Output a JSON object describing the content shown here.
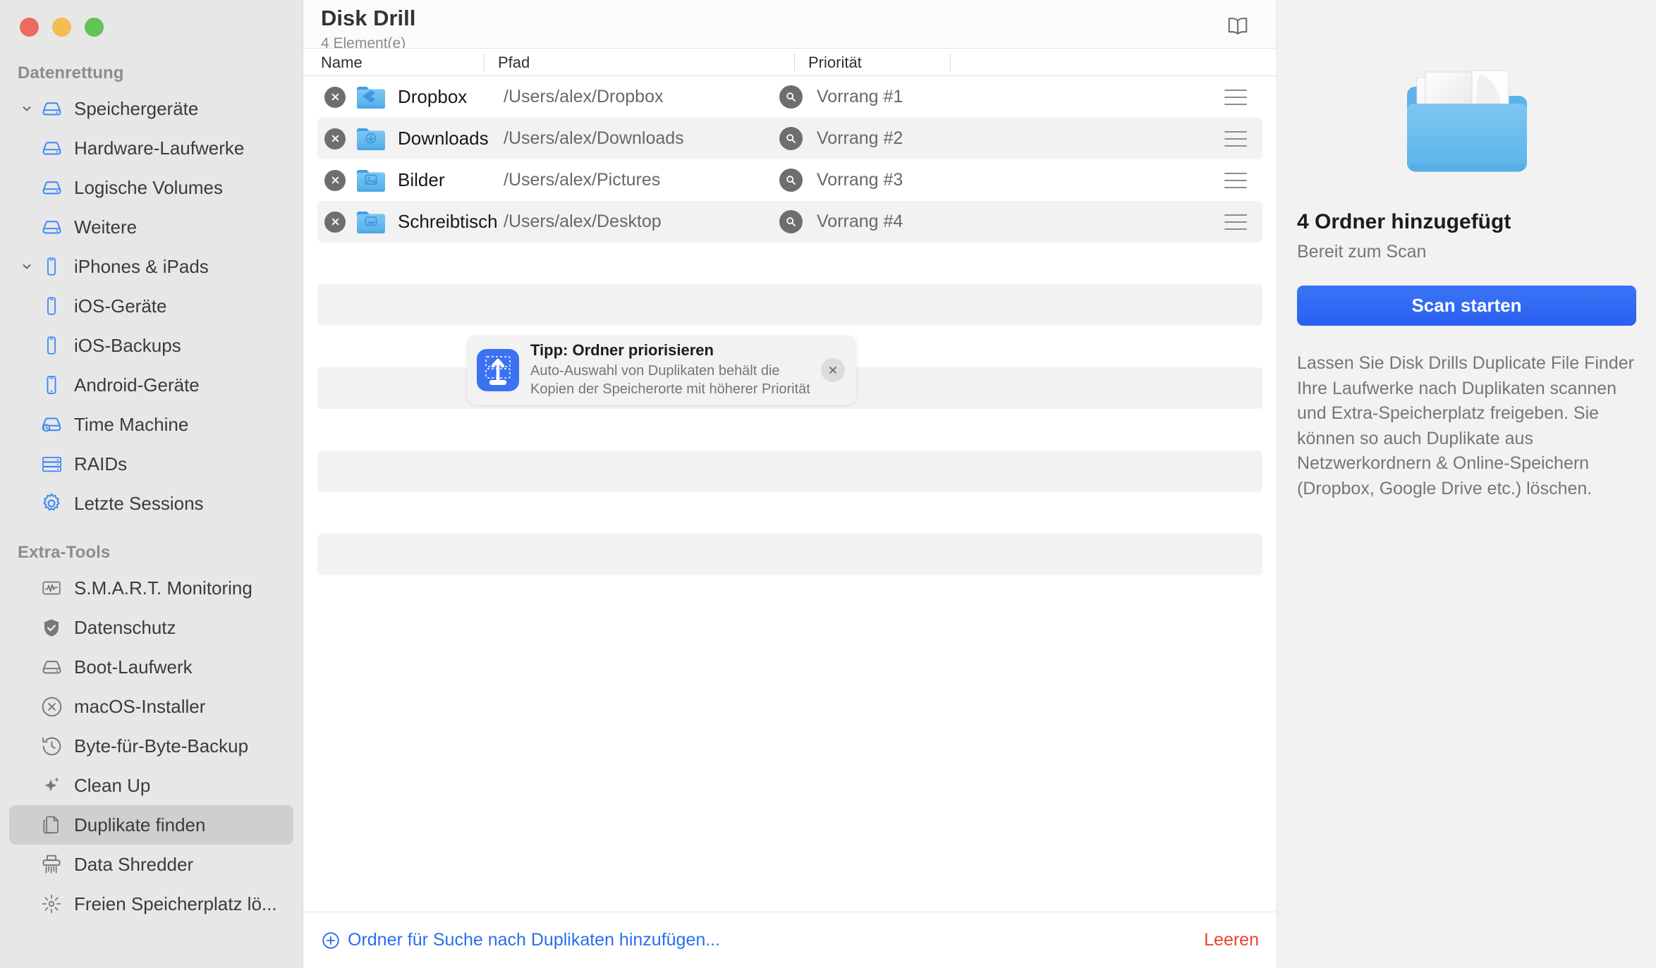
{
  "window": {
    "traffic_lights": [
      "close",
      "minimize",
      "zoom"
    ],
    "colors": {
      "close": "#ec6a5e",
      "minimize": "#f4bd4f",
      "zoom": "#61c454",
      "accent_blue": "#2a6ef0",
      "danger_red": "#e8452c"
    }
  },
  "sidebar": {
    "sections": [
      {
        "title": "Datenrettung",
        "items": [
          {
            "label": "Speichergeräte",
            "icon": "drive-icon",
            "indent": 0,
            "expandable": true,
            "expanded": true,
            "selected": false
          },
          {
            "label": "Hardware-Laufwerke",
            "icon": "drive-icon",
            "indent": 1,
            "expandable": false,
            "selected": false
          },
          {
            "label": "Logische Volumes",
            "icon": "drive-icon",
            "indent": 1,
            "expandable": false,
            "selected": false
          },
          {
            "label": "Weitere",
            "icon": "drive-icon",
            "indent": 1,
            "expandable": false,
            "selected": false
          },
          {
            "label": "iPhones & iPads",
            "icon": "phone-icon",
            "indent": 0,
            "expandable": true,
            "expanded": true,
            "selected": false
          },
          {
            "label": "iOS-Geräte",
            "icon": "phone-icon",
            "indent": 1,
            "expandable": false,
            "selected": false
          },
          {
            "label": "iOS-Backups",
            "icon": "phone-icon",
            "indent": 1,
            "expandable": false,
            "selected": false
          },
          {
            "label": "Android-Geräte",
            "icon": "android-phone-icon",
            "indent": 0,
            "expandable": false,
            "selected": false
          },
          {
            "label": "Time Machine",
            "icon": "time-machine-icon",
            "indent": 0,
            "expandable": false,
            "selected": false
          },
          {
            "label": "RAIDs",
            "icon": "raid-icon",
            "indent": 0,
            "expandable": false,
            "selected": false
          },
          {
            "label": "Letzte Sessions",
            "icon": "gear-icon",
            "indent": 0,
            "expandable": false,
            "selected": false
          }
        ]
      },
      {
        "title": "Extra-Tools",
        "items": [
          {
            "label": "S.M.A.R.T. Monitoring",
            "icon": "pulse-monitor-icon",
            "indent": 0,
            "expandable": false,
            "selected": false
          },
          {
            "label": "Datenschutz",
            "icon": "shield-check-icon",
            "indent": 0,
            "expandable": false,
            "selected": false
          },
          {
            "label": "Boot-Laufwerk",
            "icon": "drive-icon",
            "indent": 0,
            "expandable": false,
            "selected": false
          },
          {
            "label": "macOS-Installer",
            "icon": "x-circle-icon",
            "indent": 0,
            "expandable": false,
            "selected": false
          },
          {
            "label": "Byte-für-Byte-Backup",
            "icon": "clock-rewind-icon",
            "indent": 0,
            "expandable": false,
            "selected": false
          },
          {
            "label": "Clean Up",
            "icon": "sparkle-icon",
            "indent": 0,
            "expandable": false,
            "selected": false
          },
          {
            "label": "Duplikate finden",
            "icon": "copy-documents-icon",
            "indent": 0,
            "expandable": false,
            "selected": true
          },
          {
            "label": "Data Shredder",
            "icon": "shredder-icon",
            "indent": 0,
            "expandable": false,
            "selected": false
          },
          {
            "label": "Freien Speicherplatz lö...",
            "icon": "erase-sparkle-icon",
            "indent": 0,
            "expandable": false,
            "selected": false
          }
        ]
      }
    ]
  },
  "header": {
    "title": "Disk Drill",
    "subtitle": "4 Element(e)",
    "book_icon": "open-book-icon"
  },
  "table": {
    "columns": [
      {
        "key": "name",
        "label": "Name"
      },
      {
        "key": "path",
        "label": "Pfad"
      },
      {
        "key": "priority",
        "label": "Priorität"
      }
    ],
    "rows": [
      {
        "name": "Dropbox",
        "path": "/Users/alex/Dropbox",
        "priority": "Vorrang #1",
        "folder_icon": "dropbox-folder-icon",
        "remove_icon": "remove-circle-icon",
        "search_icon": "magnifier-circle-icon",
        "drag_icon": "drag-handle-icon"
      },
      {
        "name": "Downloads",
        "path": "/Users/alex/Downloads",
        "priority": "Vorrang #2",
        "folder_icon": "downloads-folder-icon",
        "remove_icon": "remove-circle-icon",
        "search_icon": "magnifier-circle-icon",
        "drag_icon": "drag-handle-icon"
      },
      {
        "name": "Bilder",
        "path": "/Users/alex/Pictures",
        "priority": "Vorrang #3",
        "folder_icon": "pictures-folder-icon",
        "remove_icon": "remove-circle-icon",
        "search_icon": "magnifier-circle-icon",
        "drag_icon": "drag-handle-icon"
      },
      {
        "name": "Schreibtisch",
        "path": "/Users/alex/Desktop",
        "priority": "Vorrang #4",
        "folder_icon": "desktop-folder-icon",
        "remove_icon": "remove-circle-icon",
        "search_icon": "magnifier-circle-icon",
        "drag_icon": "drag-handle-icon"
      }
    ],
    "empty_placeholder_rows": 8
  },
  "tip": {
    "icon": "prioritize-folder-icon",
    "title": "Tipp: Ordner priorisieren",
    "body": "Auto-Auswahl von Duplikaten behält die Kopien der Speicherorte mit höherer Priorität",
    "close_icon": "close-icon"
  },
  "footer": {
    "add_icon": "plus-circle-icon",
    "add_label": "Ordner für Suche nach Duplikaten hinzufügen...",
    "clear_label": "Leeren"
  },
  "right_panel": {
    "illustration": "folder-with-documents-icon",
    "title": "4 Ordner hinzugefügt",
    "subtitle": "Bereit zum Scan",
    "scan_button": "Scan starten",
    "description": "Lassen Sie Disk Drills Duplicate File Finder Ihre Laufwerke nach Duplikaten scannen und Extra-Speicherplatz freigeben. Sie können so auch Duplikate aus Netzwerkordnern & Online-Speichern (Dropbox, Google Drive etc.) löschen."
  }
}
